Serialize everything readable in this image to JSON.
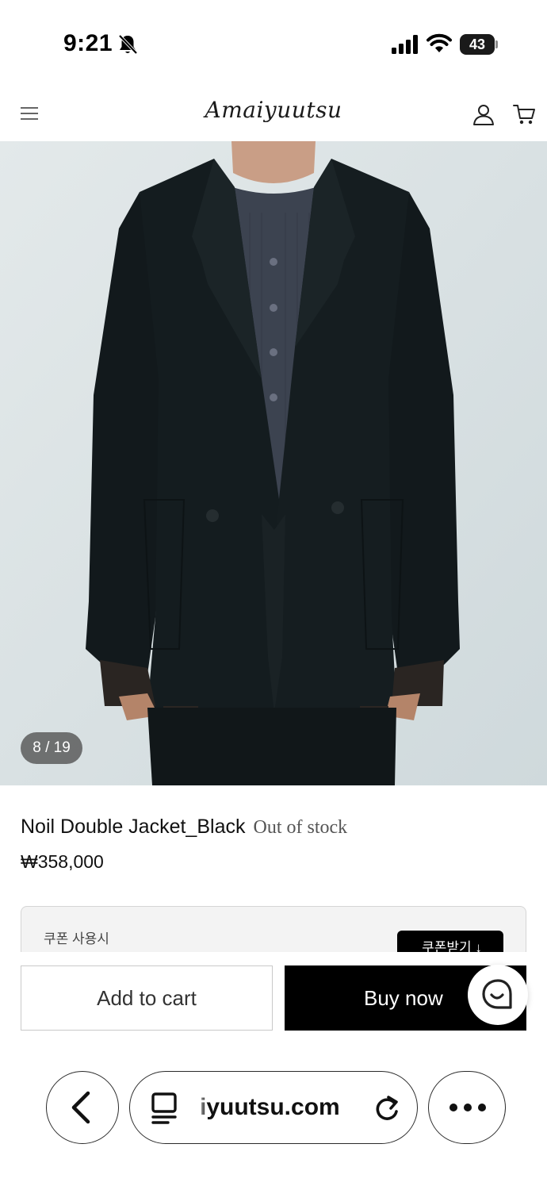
{
  "status_bar": {
    "time": "9:21",
    "battery_level": "43",
    "icons": [
      "bell-slash-icon",
      "cellular-signal-icon",
      "wifi-icon",
      "battery-icon"
    ]
  },
  "header": {
    "logo_text": "Amaiyuutsu",
    "icons": [
      "menu-icon",
      "user-icon",
      "cart-icon"
    ]
  },
  "gallery": {
    "counter": "8 / 19",
    "current_index": 8,
    "total_images": 19,
    "background_color": "#d8e0e2"
  },
  "product": {
    "name": "Noil Double Jacket_Black",
    "stock_status": "Out of stock",
    "price": "₩358,000"
  },
  "coupon": {
    "label": "쿠폰 사용시",
    "button_label": "쿠폰받기 ↓"
  },
  "actions": {
    "add_to_cart": "Add to cart",
    "buy_now": "Buy now",
    "chat_icon": "chat-bubble-icon"
  },
  "browser": {
    "url": "iyuutsu.com",
    "icons": [
      "back-chevron-icon",
      "reader-mode-icon",
      "reload-icon",
      "more-dots-icon"
    ]
  },
  "colors": {
    "accent": "#000000",
    "text_primary": "#111111",
    "text_secondary": "#555555",
    "counter_badge": "#505050",
    "coupon_background": "#f3f3f3"
  }
}
